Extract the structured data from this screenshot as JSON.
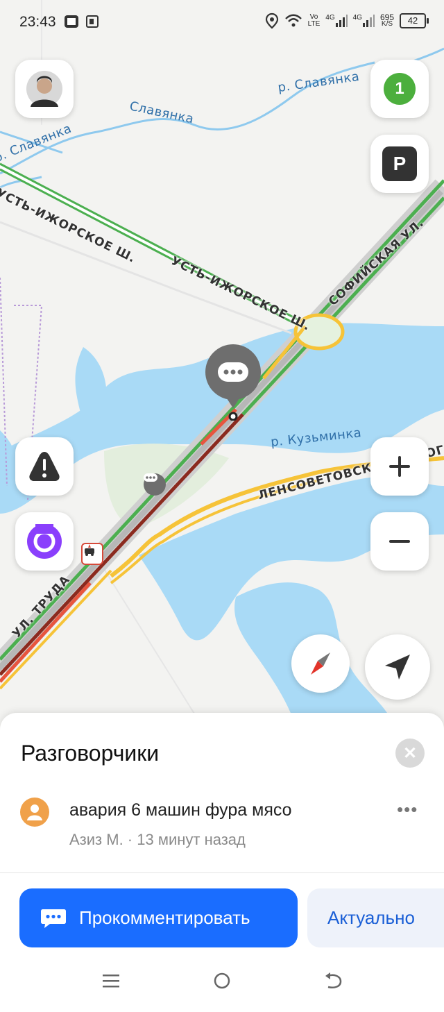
{
  "status_bar": {
    "time": "23:43",
    "network_vo": "Vo",
    "network_lte": "LTE",
    "net_4g_1": "4G",
    "net_4g_2": "4G",
    "speed_value": "695",
    "speed_unit": "K/S",
    "battery": "42"
  },
  "map": {
    "labels": {
      "river_slavyanka_top": "р. Славянка",
      "slavyanka": "Славянка",
      "river_slavyanka_left": "р. Славянка",
      "ust_izhorskoe_1": "УСТЬ-ИЖОРСКОЕ Ш.",
      "ust_izhorskoe_2": "УСТЬ-ИЖОРСКОЕ Ш.",
      "sofiyskaya": "СОФИЙСКАЯ УЛ.",
      "river_kuzminka": "р. Кузьминка",
      "lensovetovskaya": "ЛЕНСОВЕТОВСКАЯ ДОРОГА",
      "truda": "УЛ. ТРУДА"
    },
    "layers_badge": "1",
    "parking_label": "P",
    "colors": {
      "water": "#9fd6f7",
      "traffic_green": "#4caf50",
      "traffic_yellow": "#f6c338",
      "traffic_red": "#e8553e",
      "traffic_darkred": "#8b2a1f"
    }
  },
  "sheet": {
    "title": "Разговорчики",
    "comment": {
      "text": "авария 6 машин фура мясо",
      "author_time": "Азиз М. · 13 минут назад"
    },
    "comment_button": "Прокомментировать",
    "actual_button": "Актуально"
  }
}
